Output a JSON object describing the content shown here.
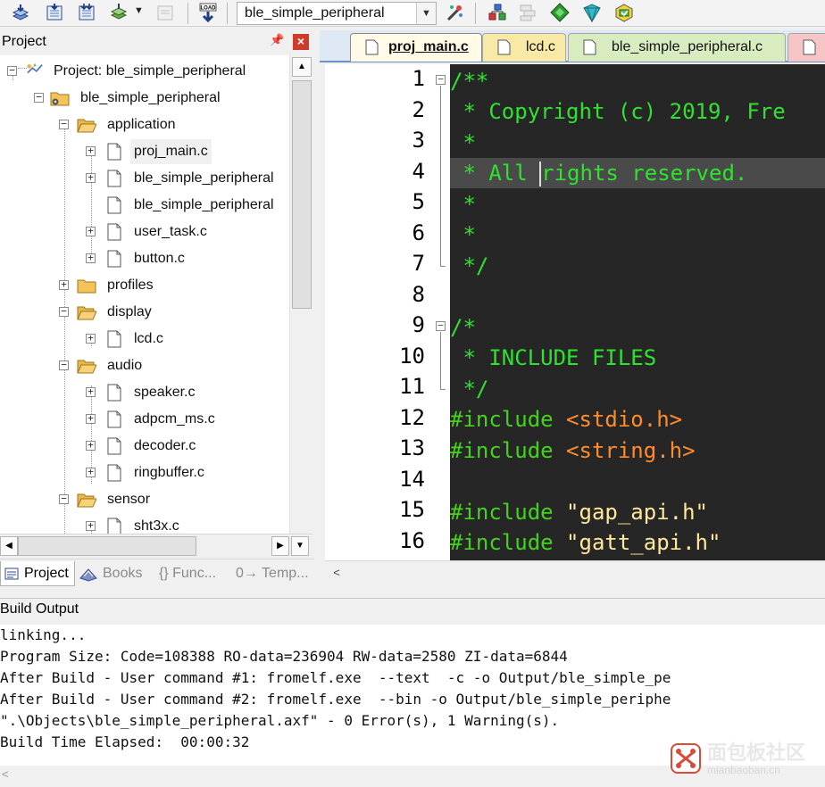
{
  "toolbar": {
    "target_name": "ble_simple_peripheral",
    "load_label": "LOAD"
  },
  "project_panel": {
    "title": "Project",
    "tree": {
      "root": "Project: ble_simple_peripheral",
      "target": "ble_simple_peripheral",
      "groups": [
        {
          "name": "application",
          "files": [
            "proj_main.c",
            "ble_simple_peripheral",
            "ble_simple_peripheral",
            "user_task.c",
            "button.c"
          ]
        },
        {
          "name": "profiles",
          "files": []
        },
        {
          "name": "display",
          "files": [
            "lcd.c"
          ]
        },
        {
          "name": "audio",
          "files": [
            "speaker.c",
            "adpcm_ms.c",
            "decoder.c",
            "ringbuffer.c"
          ]
        },
        {
          "name": "sensor",
          "files": [
            "sht3x.c"
          ]
        }
      ]
    },
    "bottom_tabs": [
      "Project",
      "Books",
      "{} Func...",
      "0→ Temp..."
    ]
  },
  "editor": {
    "tabs": [
      "proj_main.c",
      "lcd.c",
      "ble_simple_peripheral.c"
    ],
    "active_tab": "proj_main.c",
    "line_numbers": [
      "1",
      "2",
      "3",
      "4",
      "5",
      "6",
      "7",
      "8",
      "9",
      "10",
      "11",
      "12",
      "13",
      "14",
      "15",
      "16"
    ],
    "lines": [
      {
        "kind": "comment",
        "text": "/**"
      },
      {
        "kind": "comment",
        "text": " * Copyright (c) 2019, Fre"
      },
      {
        "kind": "comment",
        "text": " *"
      },
      {
        "kind": "comment",
        "text_before_caret": " * All ",
        "text_after_caret": "rights reserved."
      },
      {
        "kind": "comment",
        "text": " *"
      },
      {
        "kind": "comment",
        "text": " *"
      },
      {
        "kind": "comment",
        "text": " */"
      },
      {
        "kind": "blank",
        "text": ""
      },
      {
        "kind": "comment",
        "text": "/*"
      },
      {
        "kind": "comment",
        "text": " * INCLUDE FILES"
      },
      {
        "kind": "comment",
        "text": " */"
      },
      {
        "kind": "include_sys",
        "directive": "#include",
        "header": "<stdio.h>"
      },
      {
        "kind": "include_sys",
        "directive": "#include",
        "header": "<string.h>"
      },
      {
        "kind": "blank",
        "text": ""
      },
      {
        "kind": "include_str",
        "directive": "#include",
        "header": "\"gap_api.h\""
      },
      {
        "kind": "include_str",
        "directive": "#include",
        "header": "\"gatt_api.h\""
      }
    ],
    "colors": {
      "background": "#262626",
      "comment": "#2ee22e",
      "directive": "#44d21a",
      "system_header": "#ff8c2a",
      "string_header": "#ffe89a"
    }
  },
  "build_output": {
    "title": "Build Output",
    "lines": [
      "linking...",
      "Program Size: Code=108388 RO-data=236904 RW-data=2580 ZI-data=6844",
      "After Build - User command #1: fromelf.exe  --text  -c -o Output/ble_simple_pe",
      "After Build - User command #2: fromelf.exe  --bin -o Output/ble_simple_periphe",
      "\".\\Objects\\ble_simple_peripheral.axf\" - 0 Error(s), 1 Warning(s).",
      "Build Time Elapsed:  00:00:32"
    ]
  },
  "watermark": {
    "title": "面包板社区",
    "subtitle": "mianbaoban.cn"
  }
}
